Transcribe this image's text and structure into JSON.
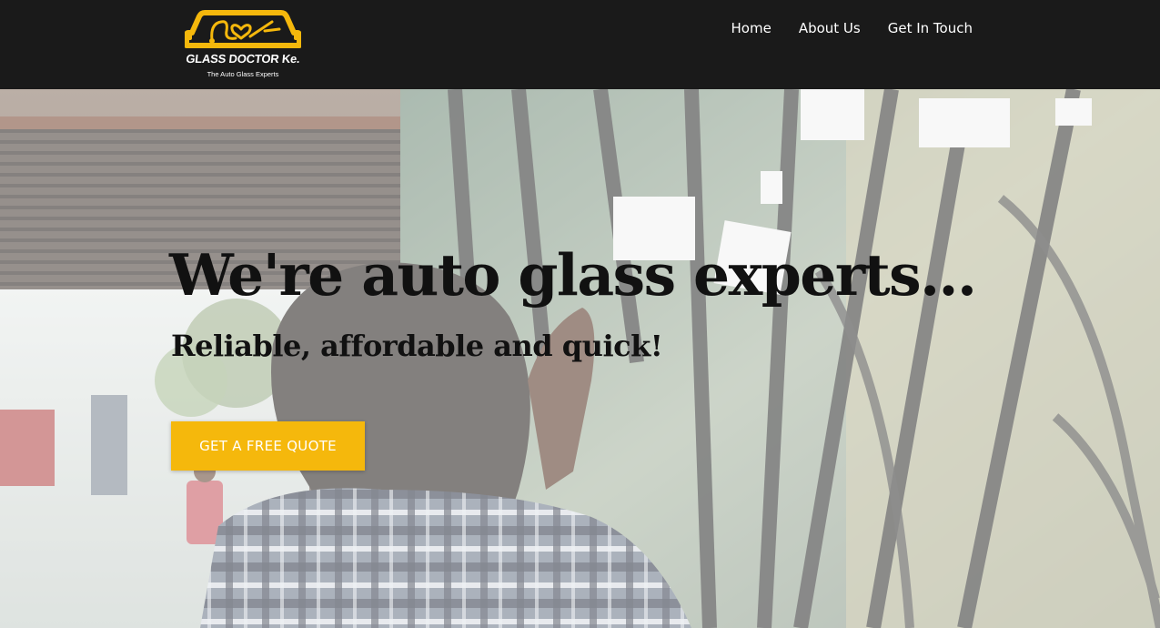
{
  "header": {
    "logo": {
      "title": "GLASS DOCTOR Ke.",
      "tagline": "The Auto Glass Experts",
      "icon": "car-windshield-stethoscope-logo",
      "color": "#F5B80C"
    },
    "nav": [
      {
        "label": "Home"
      },
      {
        "label": "About Us"
      },
      {
        "label": "Get In Touch"
      }
    ],
    "background": "#1A1A1A"
  },
  "hero": {
    "title": "We're auto glass experts...",
    "subtitle": "Reliable, affordable and quick!",
    "cta_label": "GET A FREE QUOTE",
    "cta_color": "#F5B80C"
  }
}
